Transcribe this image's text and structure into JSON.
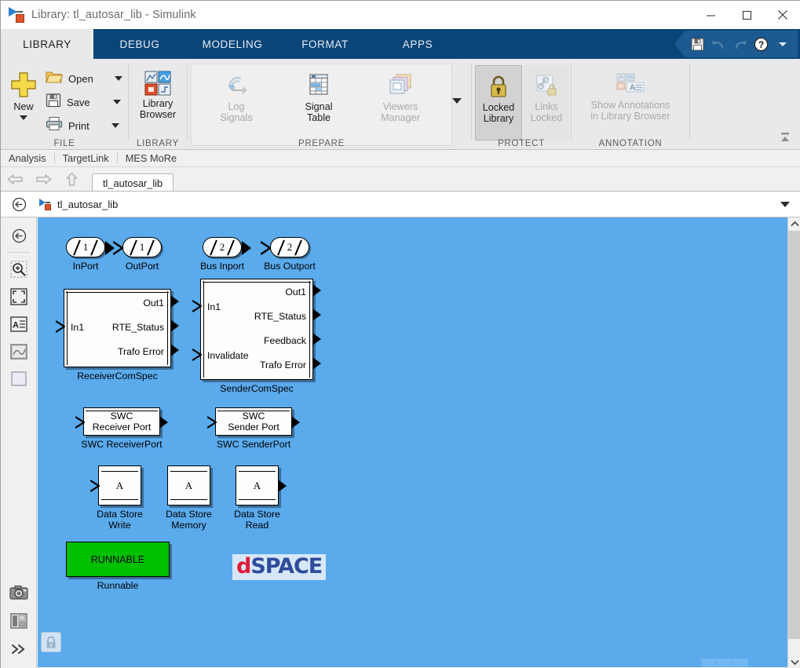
{
  "window": {
    "title": "Library: tl_autosar_lib - Simulink",
    "icon": "simulink-library-icon",
    "controls": {
      "minimize": "minimize-icon",
      "maximize": "maximize-icon",
      "close": "close-icon"
    }
  },
  "ribbon": {
    "tabs": [
      {
        "label": "LIBRARY",
        "active": true
      },
      {
        "label": "DEBUG",
        "active": false
      },
      {
        "label": "MODELING",
        "active": false
      },
      {
        "label": "FORMAT",
        "active": false
      },
      {
        "label": "APPS",
        "active": false
      }
    ],
    "quick_access": [
      {
        "name": "save-icon",
        "enabled": true
      },
      {
        "name": "undo-icon",
        "enabled": false
      },
      {
        "name": "redo-icon",
        "enabled": false
      },
      {
        "name": "help-icon",
        "enabled": true
      },
      {
        "name": "chevron-down-icon",
        "enabled": true
      }
    ],
    "groups": [
      {
        "name": "file",
        "label": "FILE",
        "new_label": "New",
        "items": [
          {
            "label": "Open",
            "icon": "folder-icon",
            "has_dropdown": true
          },
          {
            "label": "Save",
            "icon": "floppy-icon",
            "has_dropdown": true
          },
          {
            "label": "Print",
            "icon": "printer-icon",
            "has_dropdown": true
          }
        ]
      },
      {
        "name": "library",
        "label": "LIBRARY",
        "items": [
          {
            "label": "Library\nBrowser",
            "line1": "Library",
            "line2": "Browser",
            "icon": "library-browser-icon",
            "enabled": true
          }
        ]
      },
      {
        "name": "prepare",
        "label": "PREPARE",
        "items": [
          {
            "line1": "Log",
            "line2": "Signals",
            "icon": "log-signals-icon",
            "enabled": false
          },
          {
            "line1": "Signal",
            "line2": "Table",
            "icon": "signal-table-icon",
            "enabled": true
          },
          {
            "line1": "Viewers",
            "line2": "Manager",
            "icon": "viewers-manager-icon",
            "enabled": false
          }
        ],
        "expand": "chevron-down-icon"
      },
      {
        "name": "protect",
        "label": "PROTECT",
        "items": [
          {
            "line1": "Locked",
            "line2": "Library",
            "icon": "lock-icon",
            "enabled": true,
            "toggled": true
          },
          {
            "line1": "Links",
            "line2": "Locked",
            "icon": "links-locked-icon",
            "enabled": false,
            "toggled": false
          }
        ]
      },
      {
        "name": "annotation",
        "label": "ANNOTATION",
        "items": [
          {
            "line1": "Show Annotations",
            "line2": "in Library Browser",
            "icon": "annotation-icon",
            "enabled": false
          }
        ]
      }
    ],
    "collapse_icon": "ribbon-collapse-icon"
  },
  "menubar": {
    "items": [
      "Analysis",
      "TargetLink",
      "MES MoRe"
    ]
  },
  "navbar": {
    "back_icon": "back-arrow-icon",
    "forward_icon": "forward-arrow-icon",
    "up_icon": "up-arrow-icon",
    "model_tab": "tl_autosar_lib"
  },
  "pathbar": {
    "back_icon": "navigate-back-icon",
    "model_icon": "simulink-library-icon",
    "path": "tl_autosar_lib",
    "dropdown_icon": "chevron-down-icon"
  },
  "rail": {
    "items": [
      {
        "name": "navigate-back-icon"
      },
      {
        "name": "zoom-in-icon"
      },
      {
        "name": "fit-to-view-icon"
      },
      {
        "name": "annotation-text-icon"
      },
      {
        "name": "image-icon"
      },
      {
        "name": "area-icon"
      },
      {
        "name": "camera-icon"
      },
      {
        "name": "report-icon"
      },
      {
        "name": "more-chevrons-icon"
      }
    ]
  },
  "canvas": {
    "background_color": "#5aaaec",
    "lock_badge_icon": "locked-library-icon",
    "blocks": [
      {
        "id": "inport",
        "type": "port",
        "num": "1",
        "direction": "out",
        "label": "InPort"
      },
      {
        "id": "outport",
        "type": "port",
        "num": "1",
        "direction": "in",
        "label": "OutPort"
      },
      {
        "id": "bus-inport",
        "type": "port",
        "num": "2",
        "direction": "out",
        "label": "Bus Inport"
      },
      {
        "id": "bus-outport",
        "type": "port",
        "num": "2",
        "direction": "in",
        "label": "Bus Outport"
      },
      {
        "id": "receivercomspec",
        "type": "mask",
        "label": "ReceiverComSpec",
        "inputs": [
          "In1"
        ],
        "outputs": [
          "Out1",
          "RTE_Status",
          "Trafo Error"
        ]
      },
      {
        "id": "sendercomspec",
        "type": "mask",
        "label": "SenderComSpec",
        "inputs": [
          "In1",
          "Invalidate"
        ],
        "outputs": [
          "Out1",
          "RTE_Status",
          "Feedback",
          "Trafo Error"
        ]
      },
      {
        "id": "swc-receiver-port",
        "type": "swc",
        "line1": "SWC",
        "line2": "Receiver Port",
        "label": "SWC ReceiverPort"
      },
      {
        "id": "swc-sender-port",
        "type": "swc",
        "line1": "SWC",
        "line2": "Sender Port",
        "label": "SWC SenderPort"
      },
      {
        "id": "data-store-write",
        "type": "datastore",
        "glyph": "A",
        "label1": "Data Store",
        "label2": "Write"
      },
      {
        "id": "data-store-memory",
        "type": "datastore",
        "glyph": "A",
        "label1": "Data Store",
        "label2": "Memory"
      },
      {
        "id": "data-store-read",
        "type": "datastore",
        "glyph": "A",
        "label1": "Data Store",
        "label2": "Read"
      },
      {
        "id": "runnable",
        "type": "runnable",
        "text": "RUNNABLE",
        "label": "Runnable",
        "color": "#00c000"
      }
    ],
    "logo": {
      "part1": "d",
      "part2": "SPACE",
      "color1": "#e31937",
      "color2": "#2f4b9b"
    }
  },
  "scrollbars": {
    "vertical_up_icon": "chevron-up-icon",
    "vertical_down_icon": "chevron-down-icon"
  }
}
